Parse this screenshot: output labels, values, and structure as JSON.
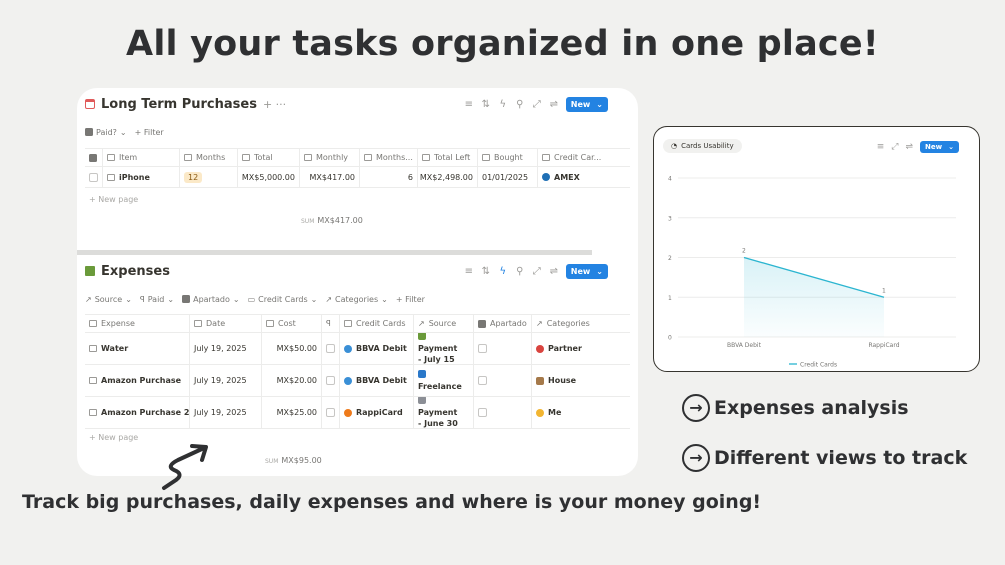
{
  "headline": "All your tasks organized in one place!",
  "tagline": "Track big purchases, daily expenses and where is your money going!",
  "features": [
    "Expenses analysis",
    "Different views to track"
  ],
  "colors": {
    "accent": "#2383e2",
    "chart_line": "#2bb5d0",
    "ink": "#2f3032"
  },
  "ltp": {
    "title": "Long Term Purchases",
    "plus_dots": "+ ···",
    "new_label": "New",
    "filters": [
      "Paid?",
      "+ Filter"
    ],
    "columns": [
      "Item",
      "Months",
      "Total",
      "Monthly",
      "Months...",
      "Total Left",
      "Bought",
      "Credit Car..."
    ],
    "row": {
      "item": "iPhone",
      "months": "12",
      "total": "MX$5,000.00",
      "monthly": "MX$417.00",
      "months_paid": "6",
      "total_left": "MX$2,498.00",
      "bought": "01/01/2025",
      "card": "AMEX"
    },
    "new_page": "+ New page",
    "sum_label": "SUM",
    "sum_value": "MX$417.00"
  },
  "expenses": {
    "title": "Expenses",
    "new_label": "New",
    "filters": [
      "Source",
      "Paid",
      "Apartado",
      "Credit Cards",
      "Categories",
      "+ Filter"
    ],
    "columns": [
      "Expense",
      "Date",
      "Cost",
      "",
      "Credit Cards",
      "Source",
      "Apartado",
      "Categories"
    ],
    "rows": [
      {
        "expense": "Water",
        "date": "July 19, 2025",
        "cost": "MX$50.00",
        "card": "BBVA Debit",
        "source1": "Payment",
        "source2": "- July 15",
        "category": "Partner"
      },
      {
        "expense": "Amazon Purchase",
        "date": "July 19, 2025",
        "cost": "MX$20.00",
        "card": "BBVA Debit",
        "source1": "",
        "source2": "Freelance",
        "category": "House"
      },
      {
        "expense": "Amazon Purchase 2",
        "date": "July 19, 2025",
        "cost": "MX$25.00",
        "card": "RappiCard",
        "source1": "Payment",
        "source2": "- June 30",
        "category": "Me"
      }
    ],
    "new_page": "+ New page",
    "sum_label": "SUM",
    "sum_value": "MX$95.00"
  },
  "chart_card": {
    "title": "Cards Usability",
    "new_label": "New"
  },
  "chart_data": {
    "type": "area",
    "categories": [
      "BBVA Debit",
      "RappiCard"
    ],
    "series": [
      {
        "name": "Credit Cards",
        "values": [
          2,
          1
        ]
      }
    ],
    "yticks": [
      "0",
      "1",
      "2",
      "3",
      "4"
    ],
    "ylim": [
      0,
      4
    ],
    "grid": true,
    "legend": "bottom"
  }
}
